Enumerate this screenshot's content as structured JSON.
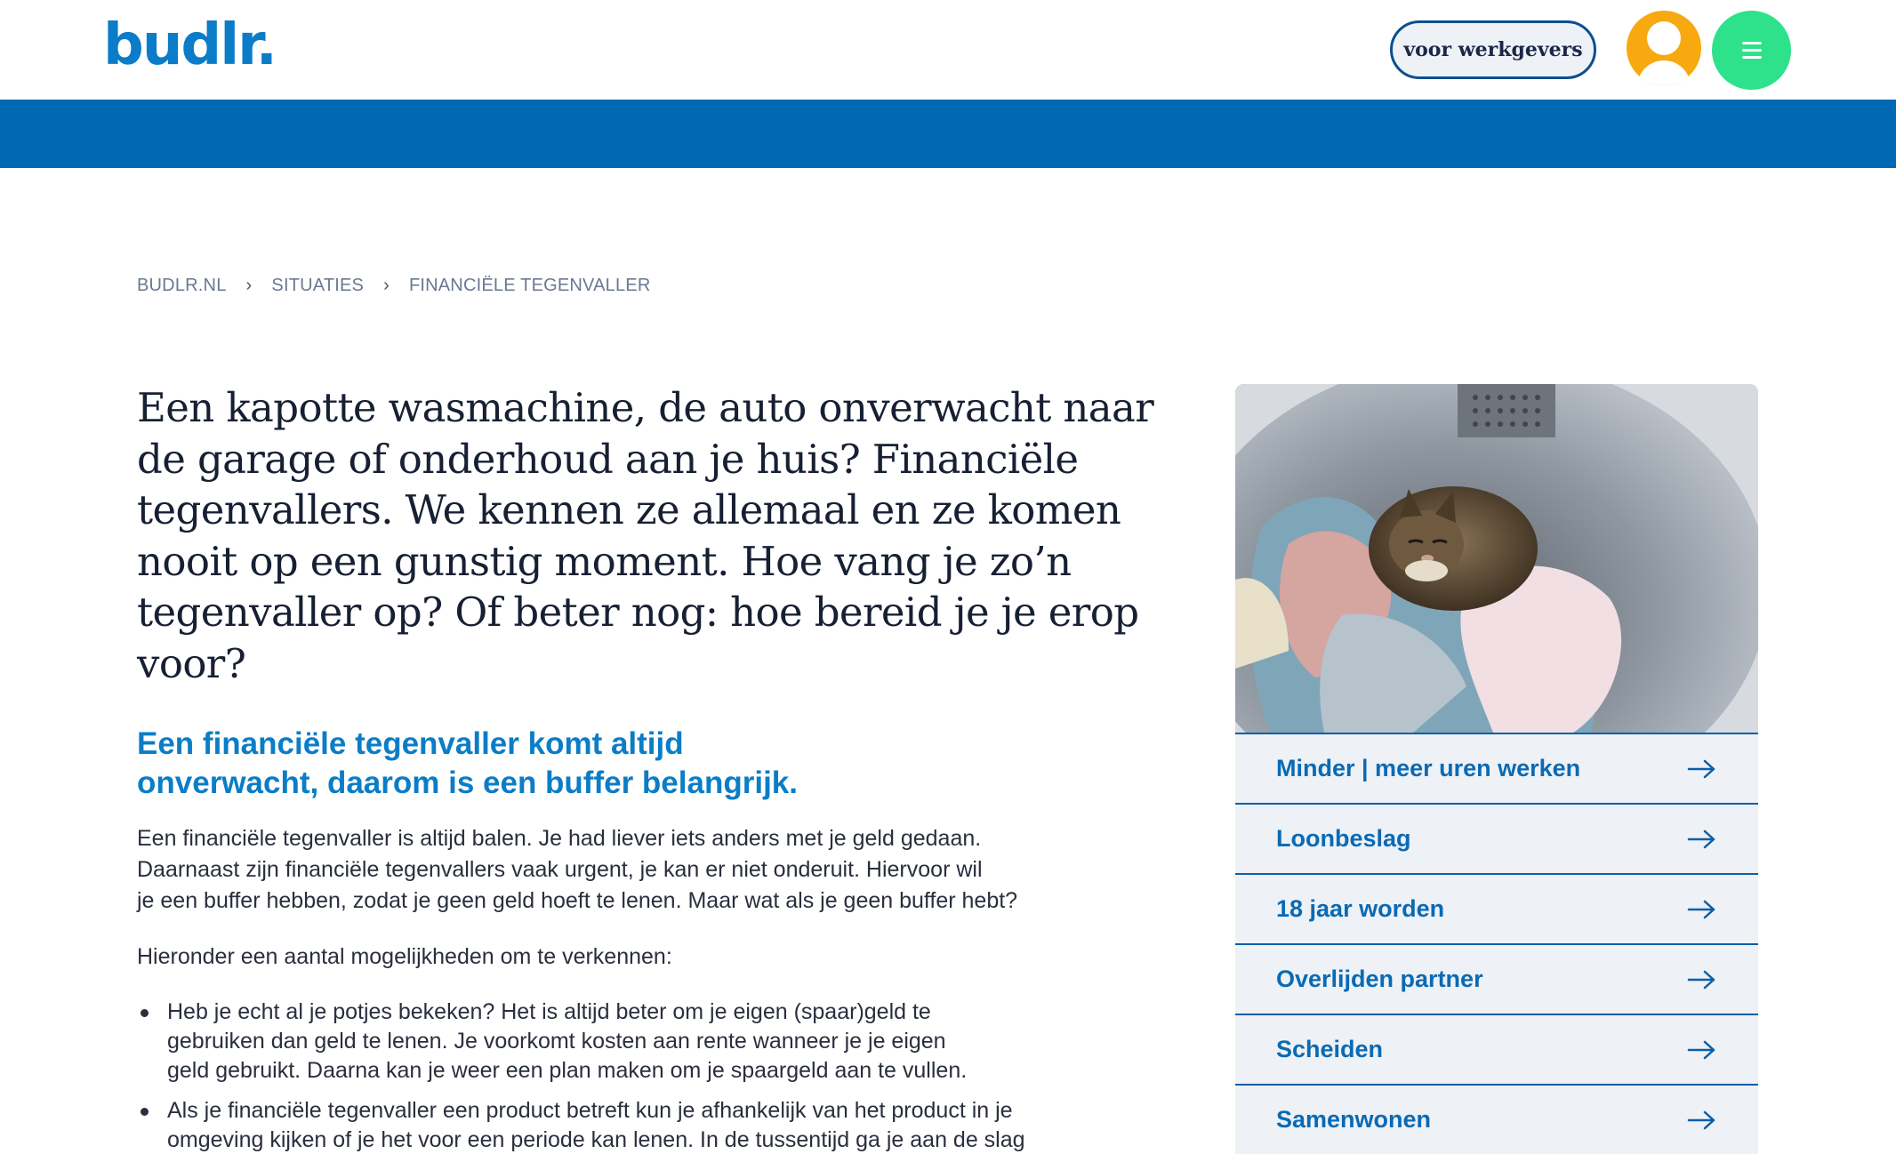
{
  "header": {
    "logo": "budlr.",
    "employers_button": "voor werkgevers",
    "account_icon": "user-avatar-icon",
    "menu_icon": "hamburger-menu-icon",
    "colors": {
      "brand": "#0a7cc8",
      "bar": "#0069b4",
      "avatar": "#f7a90f",
      "menu": "#2ee28b"
    }
  },
  "breadcrumb": [
    "BUDLR.NL",
    "SITUATIES",
    "FINANCIËLE TEGENVALLER"
  ],
  "main": {
    "intro_lines": [
      "Een kapotte wasmachine, de auto onverwacht naar",
      "de garage of onderhoud aan je huis? Financiële",
      "tegenvallers. We kennen ze allemaal en ze komen",
      "nooit op een gunstig moment. Hoe vang je zo’n",
      "tegenvaller op? Of beter nog: hoe bereid je je erop voor?"
    ],
    "subheading_lines": [
      "Een financiële tegenvaller komt altijd",
      "onverwacht, daarom is een buffer belangrijk."
    ],
    "paragraph_lines": [
      "Een financiële tegenvaller is altijd balen. Je had liever iets anders met je geld gedaan.",
      "Daarnaast zijn financiële tegenvallers vaak urgent, je kan er niet onderuit. Hiervoor wil",
      "je een buffer hebben, zodat je geen geld hoeft te lenen. Maar wat als je geen buffer hebt?"
    ],
    "list_intro": "Hieronder een aantal mogelijkheden om te verkennen:",
    "bullets": [
      [
        "Heb je echt al je potjes bekeken? Het is altijd beter om je eigen (spaar)geld te",
        "gebruiken dan geld te lenen. Je voorkomt kosten aan rente wanneer je je eigen",
        "geld gebruikt. Daarna kan je weer een plan maken om je spaargeld aan te vullen."
      ],
      [
        "Als je financiële tegenvaller een product betreft kun je afhankelijk van het product in je",
        "omgeving kijken of je het voor een periode kan lenen. In de tussentijd ga je aan de slag"
      ]
    ]
  },
  "sidebar": {
    "image_icon": "cat-in-dryer-photo",
    "links": [
      "Minder | meer uren werken",
      "Loonbeslag",
      "18 jaar worden",
      "Overlijden partner",
      "Scheiden",
      "Samenwonen"
    ],
    "link_icon": "arrow-right-icon"
  }
}
